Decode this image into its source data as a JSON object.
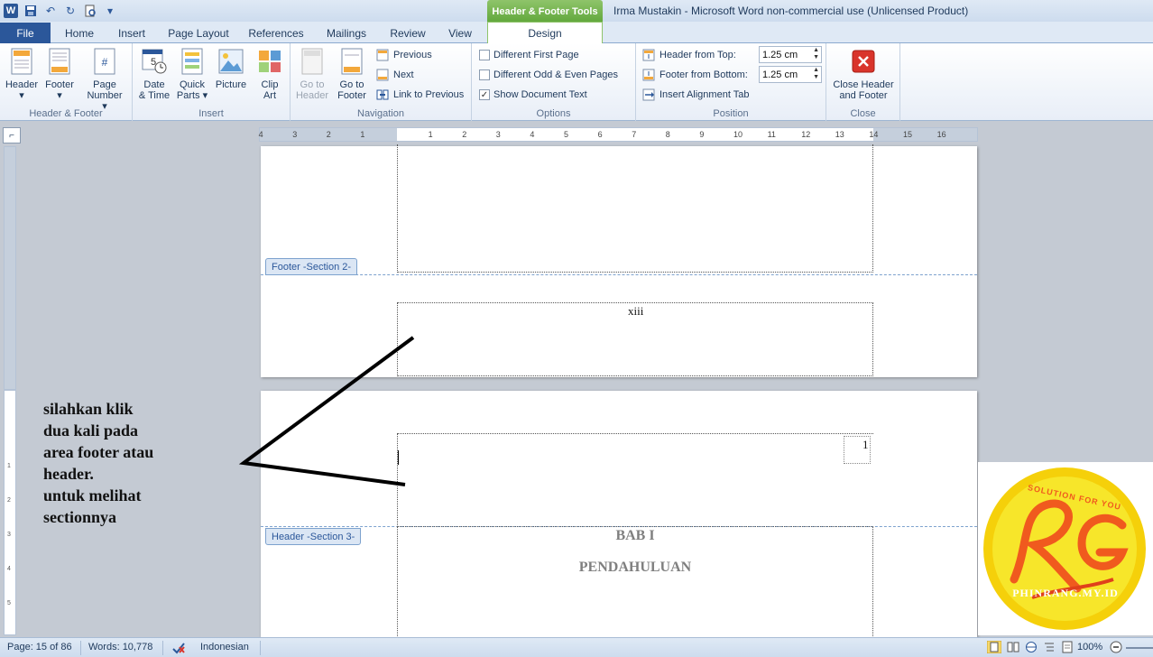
{
  "window": {
    "contextual_tab": "Header & Footer Tools",
    "title": "Irma Mustakin  -  Microsoft Word non-commercial use (Unlicensed Product)"
  },
  "tabs": [
    "File",
    "Home",
    "Insert",
    "Page Layout",
    "References",
    "Mailings",
    "Review",
    "View",
    "Design"
  ],
  "ribbon": {
    "groups": {
      "header_footer": "Header & Footer",
      "insert": "Insert",
      "navigation": "Navigation",
      "options": "Options",
      "position": "Position",
      "close": "Close"
    },
    "header_btn": "Header",
    "footer_btn": "Footer",
    "page_number_1": "Page",
    "page_number_2": "Number",
    "date_time_1": "Date",
    "date_time_2": "& Time",
    "quick_parts_1": "Quick",
    "quick_parts_2": "Parts",
    "picture": "Picture",
    "clip_art_1": "Clip",
    "clip_art_2": "Art",
    "goto_header_1": "Go to",
    "goto_header_2": "Header",
    "goto_footer_1": "Go to",
    "goto_footer_2": "Footer",
    "previous": "Previous",
    "next": "Next",
    "link_to_previous": "Link to Previous",
    "different_first_page": "Different First Page",
    "different_odd_even": "Different Odd & Even Pages",
    "show_document_text": "Show Document Text",
    "header_from_top": "Header from Top:",
    "header_from_top_value": "1.25 cm",
    "footer_from_bottom": "Footer from Bottom:",
    "footer_from_bottom_value": "1.25 cm",
    "insert_alignment_tab": "Insert Alignment Tab",
    "close_1": "Close Header",
    "close_2": "and Footer"
  },
  "ruler": {
    "labels": [
      "4",
      "3",
      "2",
      "1",
      "1",
      "2",
      "3",
      "4",
      "5",
      "6",
      "7",
      "8",
      "9",
      "10",
      "11",
      "12",
      "13",
      "14",
      "15",
      "16"
    ]
  },
  "document": {
    "footer_section_label": "Footer -Section 2-",
    "header_section_label": "Header -Section 3-",
    "roman_page": "xiii",
    "arabic_page": "1",
    "chapter": "BAB I",
    "chapter_title": "PENDAHULUAN"
  },
  "annotation": [
    "silahkan klik",
    "dua kali pada",
    "area footer atau",
    "header.",
    "untuk melihat",
    "sectionnya"
  ],
  "logo": {
    "top_text": "SOLUTION FOR YOU",
    "bottom_text": "PHINRANG.MY.ID",
    "yellow": "#f7e62a",
    "orange": "#f05a1e"
  },
  "status": {
    "page": "Page: 15 of 86",
    "words": "Words: 10,778",
    "language": "Indonesian",
    "zoom": "100%"
  }
}
